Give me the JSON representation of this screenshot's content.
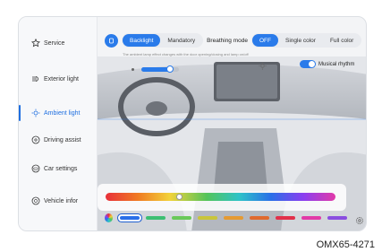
{
  "sidebar": {
    "items": [
      {
        "label": "Service",
        "icon": "star-icon"
      },
      {
        "label": "Exterior light",
        "icon": "headlight-icon"
      },
      {
        "label": "Ambient light",
        "icon": "sun-icon",
        "active": true
      },
      {
        "label": "Driving assist",
        "icon": "steering-icon"
      },
      {
        "label": "Car settings",
        "icon": "car-settings-icon"
      },
      {
        "label": "Vehicle infor",
        "icon": "info-icon"
      }
    ]
  },
  "toolbar": {
    "backlight_label": "Backlight",
    "mandatory_label": "Mandatory",
    "breathing_mode_label": "Breathing mode",
    "off_label": "OFF",
    "single_color_label": "Single color",
    "full_color_label": "Full color"
  },
  "info_text": "The ambient lamp effect changes with the door opening/closing and lamp on/off",
  "music_rhythm_label": "Musical rhythm",
  "music_rhythm_on": true,
  "brightness_level": 0.75,
  "spectrum_position": 0.32,
  "swatch_colors": [
    "#2a6fe8",
    "#3cbf72",
    "#6ac95a",
    "#c9c53a",
    "#e59a32",
    "#e06a2e",
    "#e2304a",
    "#e23aa8",
    "#8a4ee0"
  ],
  "selected_swatch": 0,
  "colors": {
    "accent": "#2a7bea",
    "active_text": "#1f6fe0"
  },
  "watermark": "OMX65-4271"
}
